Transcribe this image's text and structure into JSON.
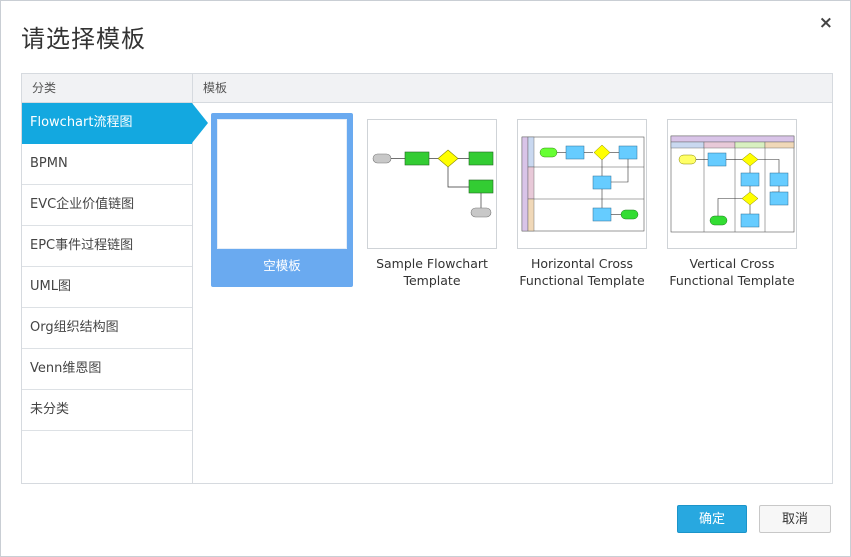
{
  "dialog": {
    "title": "请选择模板",
    "close_icon": "×"
  },
  "categories": {
    "header": "分类",
    "items": [
      {
        "label": "Flowchart流程图"
      },
      {
        "label": "BPMN"
      },
      {
        "label": "EVC企业价值链图"
      },
      {
        "label": "EPC事件过程链图"
      },
      {
        "label": "UML图"
      },
      {
        "label": "Org组织结构图"
      },
      {
        "label": "Venn维恩图"
      },
      {
        "label": "未分类"
      }
    ]
  },
  "templates": {
    "header": "模板",
    "items": [
      {
        "name": "空模板"
      },
      {
        "name": "Sample Flowchart Template"
      },
      {
        "name": "Horizontal Cross Functional Template"
      },
      {
        "name": "Vertical Cross Functional Template"
      }
    ]
  },
  "buttons": {
    "ok": "确定",
    "cancel": "取消"
  },
  "colors": {
    "active_category": "#13a8e0",
    "selected_template": "#6aaaf0",
    "ok_button": "#28a8e0",
    "flow_process": "#33cc33",
    "flow_decision": "#ffff00",
    "flow_lane_process": "#66ccff"
  }
}
